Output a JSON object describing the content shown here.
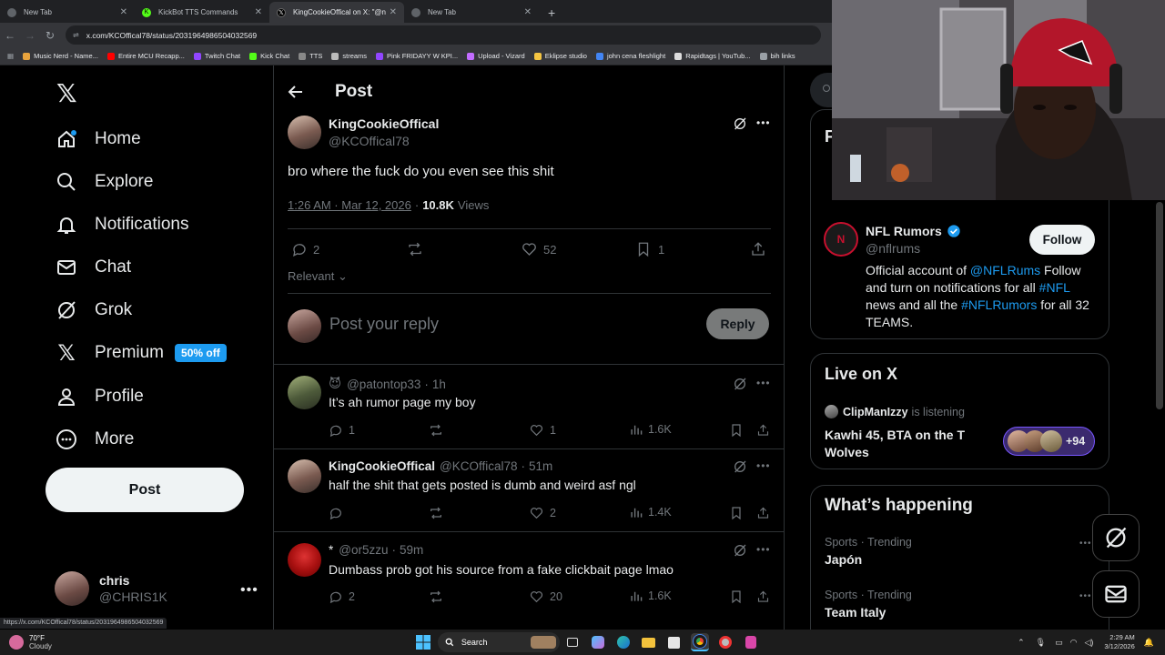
{
  "browser": {
    "tabs": [
      {
        "title": "New Tab",
        "active": false
      },
      {
        "title": "KickBot TTS Commands",
        "active": false
      },
      {
        "title": "KingCookieOffical on X: \"@nfl",
        "active": true
      },
      {
        "title": "New Tab",
        "active": false
      }
    ],
    "url": "x.com/KCOffical78/status/2031964986504032569",
    "bookmarks": [
      "Music Nerd - Name...",
      "Entire MCU Recapp...",
      "Twitch Chat",
      "Kick Chat",
      "TTS",
      "streams",
      "Pink FRIDAYY W KPI...",
      "Upload - Vizard",
      "Eklipse studio",
      "john cena fleshlight",
      "Rapidtags | YouTub...",
      "bih links"
    ],
    "status_url": "https://x.com/KCOffical78/status/2031964986504032569"
  },
  "sidebar": {
    "items": [
      {
        "label": "Home",
        "icon": "home-icon"
      },
      {
        "label": "Explore",
        "icon": "search-icon"
      },
      {
        "label": "Notifications",
        "icon": "bell-icon"
      },
      {
        "label": "Chat",
        "icon": "mail-icon"
      },
      {
        "label": "Grok",
        "icon": "grok-icon"
      },
      {
        "label": "Premium",
        "icon": "x-logo-icon",
        "badge": "50% off"
      },
      {
        "label": "Profile",
        "icon": "person-icon"
      },
      {
        "label": "More",
        "icon": "more-circle-icon"
      }
    ],
    "post_button": "Post",
    "account": {
      "name": "chris",
      "handle": "@CHRIS1K"
    }
  },
  "post": {
    "header_title": "Post",
    "author_name": "KingCookieOffical",
    "author_handle": "@KCOffical78",
    "text": "bro where the fuck do you even see this shit",
    "timestamp": "1:26 AM · Mar 12, 2026",
    "views_count": "10.8K",
    "views_label": "Views",
    "replies": "2",
    "likes": "52",
    "bookmarks": "1",
    "sort_label": "Relevant",
    "reply_placeholder": "Post your reply",
    "reply_button": "Reply"
  },
  "replies": [
    {
      "name": "",
      "prefix": "😈",
      "handle": "@patontop33",
      "time": "1h",
      "text": "It’s ah rumor page my boy",
      "replies": "1",
      "retweets": "",
      "likes": "1",
      "views": "1.6K"
    },
    {
      "name": "KingCookieOffical",
      "prefix": "",
      "handle": "@KCOffical78",
      "time": "51m",
      "text": "half the shit that gets posted is dumb and weird asf ngl",
      "replies": "",
      "retweets": "",
      "likes": "2",
      "views": "1.4K"
    },
    {
      "name": "",
      "prefix": "*",
      "handle": "@or5zzu",
      "time": "59m",
      "text": "Dumbass prob got his source from a fake clickbait page lmao",
      "replies": "2",
      "retweets": "",
      "likes": "20",
      "views": "1.6K"
    }
  ],
  "right": {
    "profile_card": {
      "name": "NFL Rumors",
      "handle": "@nflrums",
      "follow": "Follow",
      "bio_parts": [
        "Official account of ",
        "@NFLRums",
        " Follow and turn on notifications for all ",
        "#NFL",
        " news and all the ",
        "#NFLRumors",
        " for all 32 TEAMS."
      ]
    },
    "live": {
      "title": "Live on X",
      "host": "ClipManIzzy",
      "status": "is listening",
      "space_title": "Kawhi 45, BTA on the T Wolves",
      "count": "+94"
    },
    "happening": {
      "title": "What’s happening",
      "trends": [
        {
          "meta": "Sports · Trending",
          "name": "Japón"
        },
        {
          "meta": "Sports · Trending",
          "name": "Team Italy"
        }
      ]
    }
  },
  "taskbar": {
    "weather_temp": "70°F",
    "weather_desc": "Cloudy",
    "search": "Search",
    "time": "2:29 AM",
    "date": "3/12/2026"
  },
  "colors": {
    "accent": "#1d9bf0",
    "background": "#000000",
    "border": "#2f3336",
    "muted": "#71767b"
  }
}
